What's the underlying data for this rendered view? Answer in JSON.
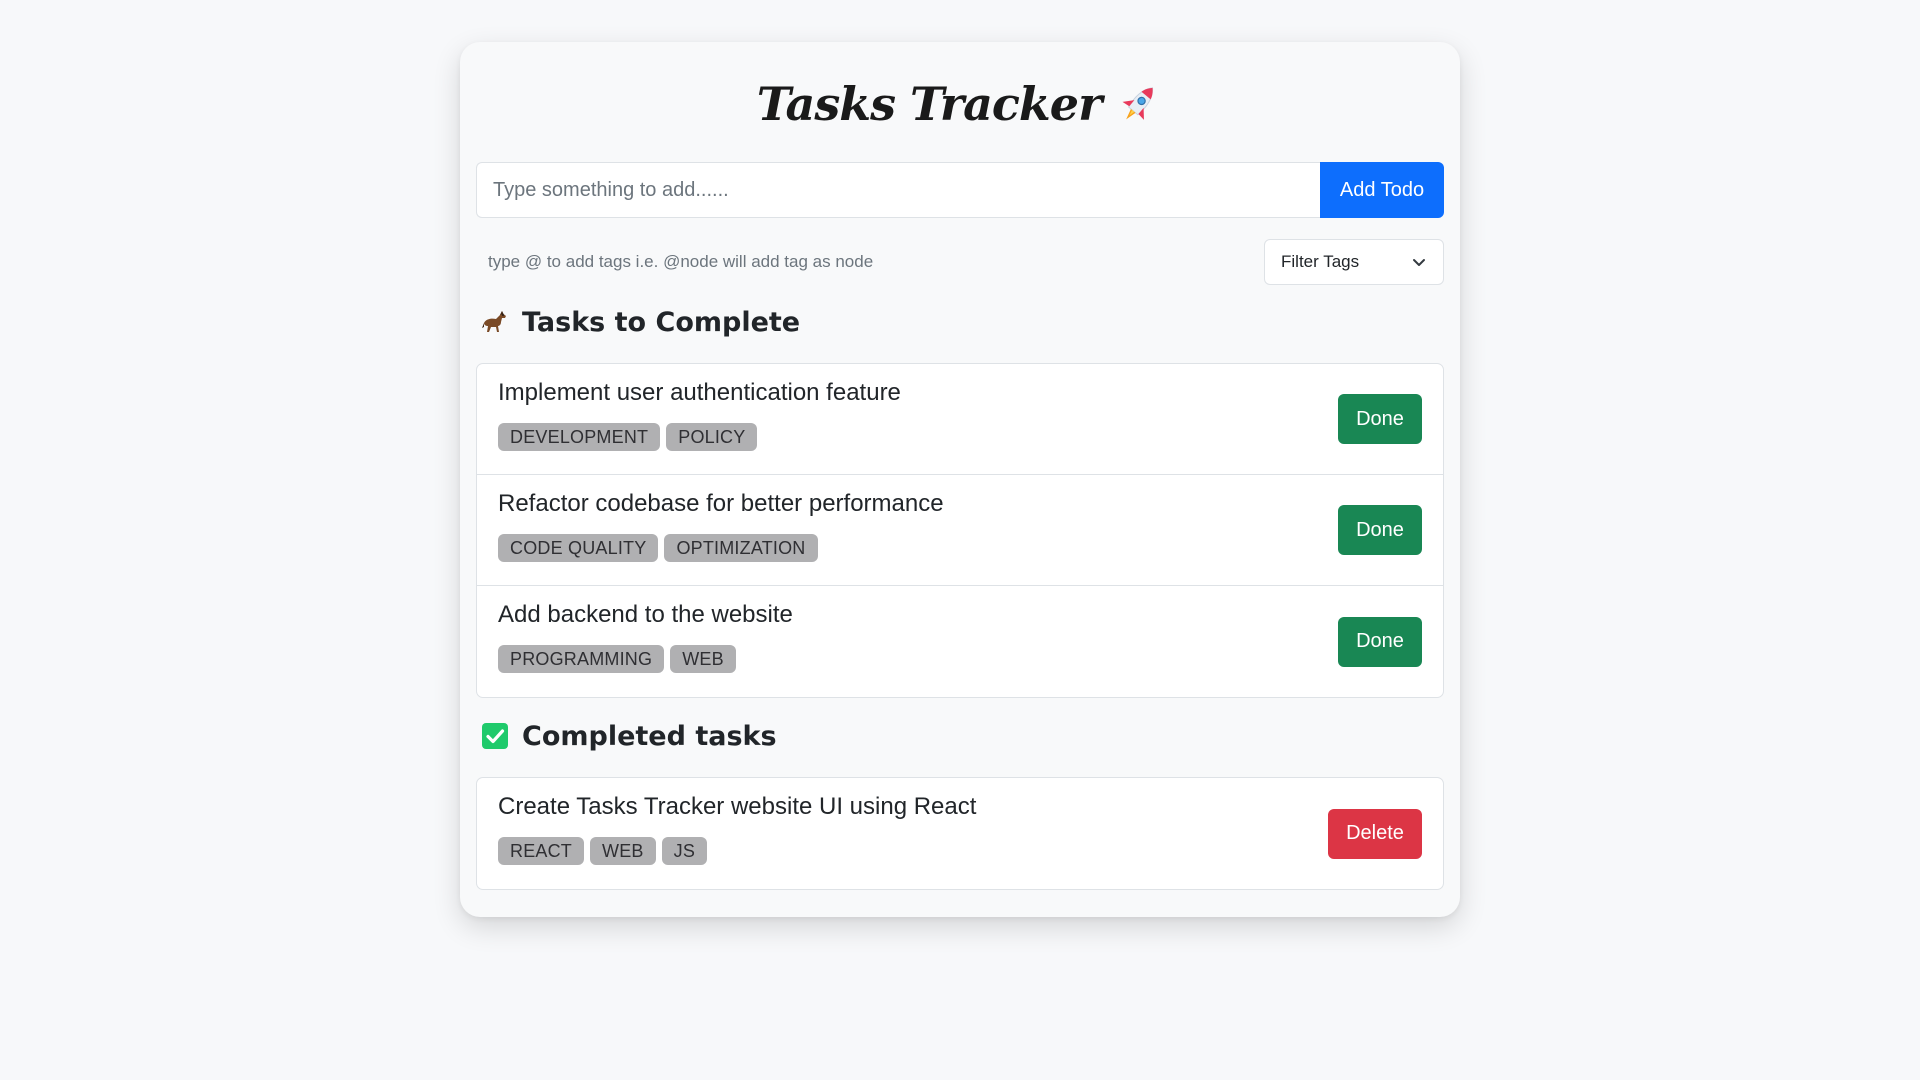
{
  "app": {
    "title": "Tasks Tracker"
  },
  "add_form": {
    "placeholder": "Type something to add......",
    "value": "",
    "button_label": "Add Todo"
  },
  "hint": "type @ to add tags i.e. @node will add tag as node",
  "filter": {
    "label": "Filter Tags"
  },
  "todo_section": {
    "title": "Tasks to Complete",
    "icon": "horse-icon",
    "items": [
      {
        "title": "Implement user authentication feature",
        "tags": [
          "DEVELOPMENT",
          "POLICY"
        ],
        "action": "Done"
      },
      {
        "title": "Refactor codebase for better performance",
        "tags": [
          "CODE QUALITY",
          "OPTIMIZATION"
        ],
        "action": "Done"
      },
      {
        "title": "Add backend to the website",
        "tags": [
          "PROGRAMMING",
          "WEB"
        ],
        "action": "Done"
      }
    ]
  },
  "done_section": {
    "title": "Completed tasks",
    "icon": "check-box-icon",
    "items": [
      {
        "title": "Create Tasks Tracker website UI using React",
        "tags": [
          "REACT",
          "WEB",
          "JS"
        ],
        "action": "Delete"
      }
    ]
  },
  "colors": {
    "primary": "#0d6efd",
    "success": "#198754",
    "danger": "#dc3545",
    "tag_bg": "#b0b0b2",
    "check_green": "#1fca6b"
  }
}
